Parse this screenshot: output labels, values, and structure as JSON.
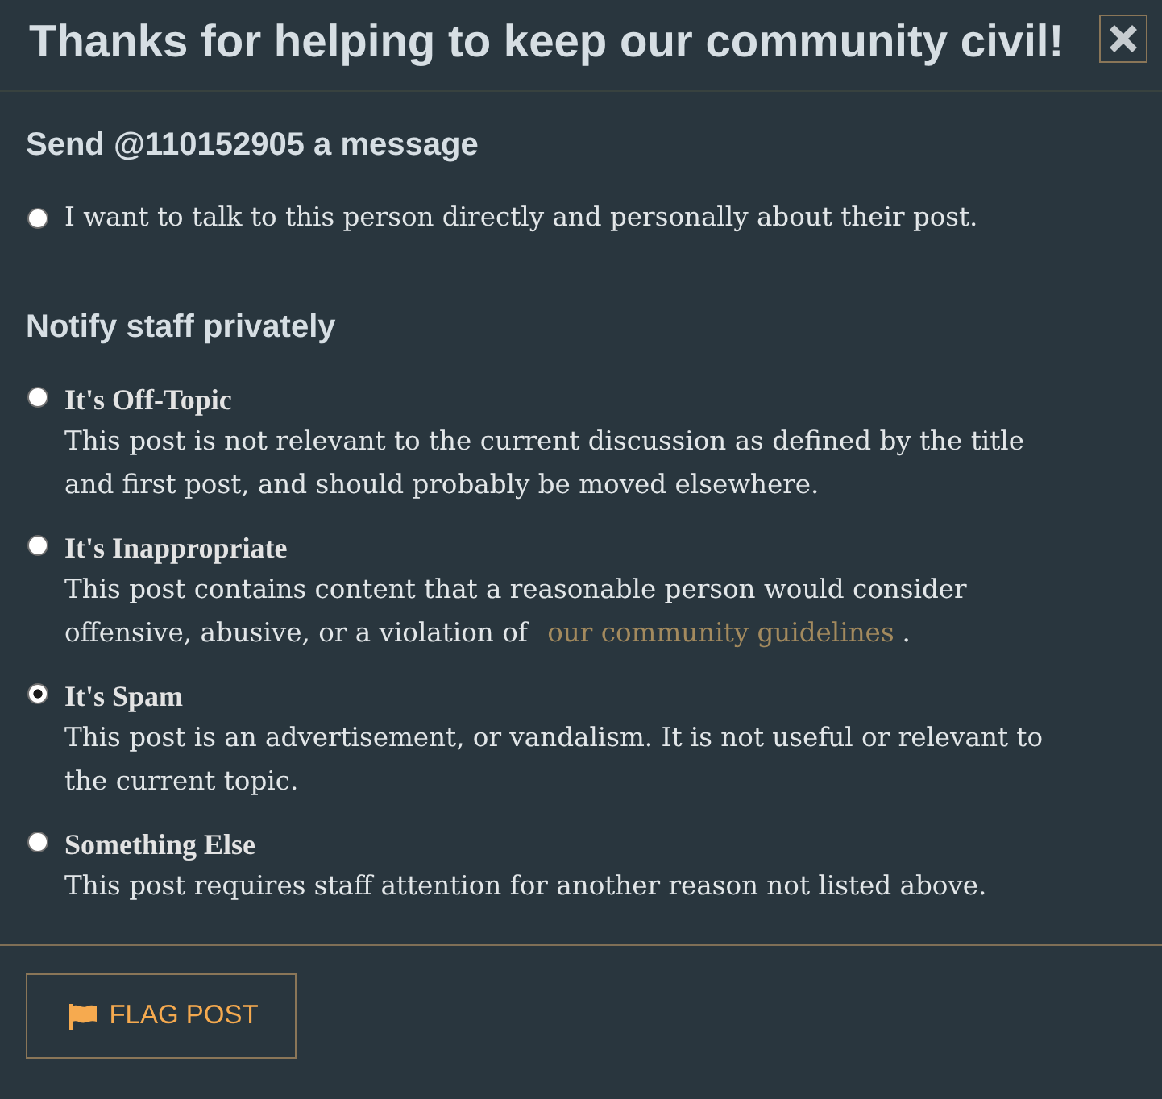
{
  "dialog": {
    "title": "Thanks for helping to keep our community civil!"
  },
  "sections": [
    {
      "heading": "Send @110152905 a message",
      "options": [
        {
          "kind": "plain",
          "label": "I want to talk to this person directly and personally about their post.",
          "selected": false
        }
      ]
    },
    {
      "heading": "Notify staff privately",
      "options": [
        {
          "kind": "described",
          "label": "It's Off-Topic",
          "description": "This post is not relevant to the current discussion as defined by the title and first post, and should probably be moved elsewhere.",
          "selected": false
        },
        {
          "kind": "described",
          "label": "It's Inappropriate",
          "description": "This post contains content that a reasonable person would consider offensive, abusive, or a violation of",
          "link": "our community guidelines",
          "after_link": ".",
          "selected": false
        },
        {
          "kind": "described",
          "label": "It's Spam",
          "description": "This post is an advertisement, or vandalism. It is not useful or relevant to the current topic.",
          "selected": true
        },
        {
          "kind": "described",
          "label": "Something Else",
          "description": "This post requires staff attention for another reason not listed above.",
          "selected": false
        }
      ]
    }
  ],
  "footer": {
    "button": {
      "label": "FLAG POST"
    }
  }
}
